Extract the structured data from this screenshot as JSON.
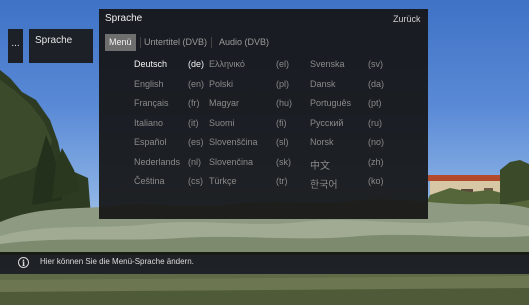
{
  "breadcrumb": {
    "more": "...",
    "current": "Sprache"
  },
  "panel": {
    "title": "Sprache",
    "back_label": "Zurück",
    "tabs": [
      {
        "label": "Menü",
        "active": true
      },
      {
        "label": "Untertitel (DVB)",
        "active": false
      },
      {
        "label": "Audio (DVB)",
        "active": false
      }
    ],
    "languages": [
      {
        "name": "Deutsch",
        "code": "(de)",
        "selected": true
      },
      {
        "name": "English",
        "code": "(en)"
      },
      {
        "name": "Français",
        "code": "(fr)"
      },
      {
        "name": "Italiano",
        "code": "(it)"
      },
      {
        "name": "Español",
        "code": "(es)"
      },
      {
        "name": "Nederlands",
        "code": "(nl)"
      },
      {
        "name": "Čeština",
        "code": "(cs)"
      },
      {
        "name": "Ελληνικό",
        "code": "(el)"
      },
      {
        "name": "Polski",
        "code": "(pl)"
      },
      {
        "name": "Magyar",
        "code": "(hu)"
      },
      {
        "name": "Suomi",
        "code": "(fi)"
      },
      {
        "name": "Slovenščina",
        "code": "(sl)"
      },
      {
        "name": "Slovenčina",
        "code": "(sk)"
      },
      {
        "name": "Türkçe",
        "code": "(tr)"
      },
      {
        "name": "Svenska",
        "code": "(sv)"
      },
      {
        "name": "Dansk",
        "code": "(da)"
      },
      {
        "name": "Português",
        "code": "(pt)"
      },
      {
        "name": "Русский",
        "code": "(ru)"
      },
      {
        "name": "Norsk",
        "code": "(no)"
      },
      {
        "name": "中文",
        "code": "(zh)"
      },
      {
        "name": "한국어",
        "code": "(ko)"
      }
    ]
  },
  "info": {
    "icon": "info-icon",
    "text": "Hier können Sie die Menü-Sprache ändern."
  },
  "colors": {
    "panel_bg": "#161616",
    "active_tab": "#6e6e6e",
    "selected_text": "#f4f4f4",
    "dim_text": "#8a8a8a"
  }
}
